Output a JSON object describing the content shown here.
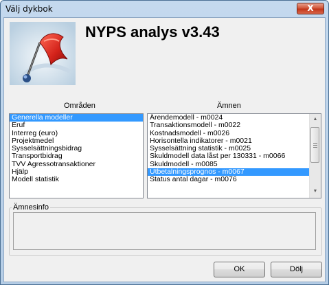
{
  "window": {
    "title": "Välj dykbok",
    "close_label": "X"
  },
  "header": {
    "app_title": "NYPS analys v3.43"
  },
  "areas": {
    "label": "Områden",
    "items": [
      {
        "label": "Generella modeller",
        "selected": true
      },
      {
        "label": "Eruf"
      },
      {
        "label": "Interreg (euro)"
      },
      {
        "label": "Projektmedel"
      },
      {
        "label": "Sysselsättningsbidrag"
      },
      {
        "label": "Transportbidrag"
      },
      {
        "label": "TVV Agressotransaktioner"
      },
      {
        "label": "Hjälp"
      },
      {
        "label": "Modell statistik"
      }
    ]
  },
  "subjects": {
    "label": "Ämnen",
    "items": [
      {
        "label": "Ärendemodell - m0024"
      },
      {
        "label": "Transaktionsmodell - m0022"
      },
      {
        "label": "Kostnadsmodell - m0026"
      },
      {
        "label": "Horisontella indikatorer - m0021"
      },
      {
        "label": "Sysselsättning statistik - m0025"
      },
      {
        "label": "Skuldmodell data låst per 130331 - m0066"
      },
      {
        "label": "Skuldmodell - m0085"
      },
      {
        "label": "Utbetalningsprognos - m0067",
        "selected": true
      },
      {
        "label": "Status antal dagar - m0076"
      }
    ]
  },
  "info": {
    "label": "Ämnesinfo"
  },
  "buttons": {
    "ok": "OK",
    "hide": "Dölj"
  },
  "colors": {
    "selection": "#3399ff",
    "close_button": "#c2361a",
    "titlebar": "#b9d1ea"
  }
}
